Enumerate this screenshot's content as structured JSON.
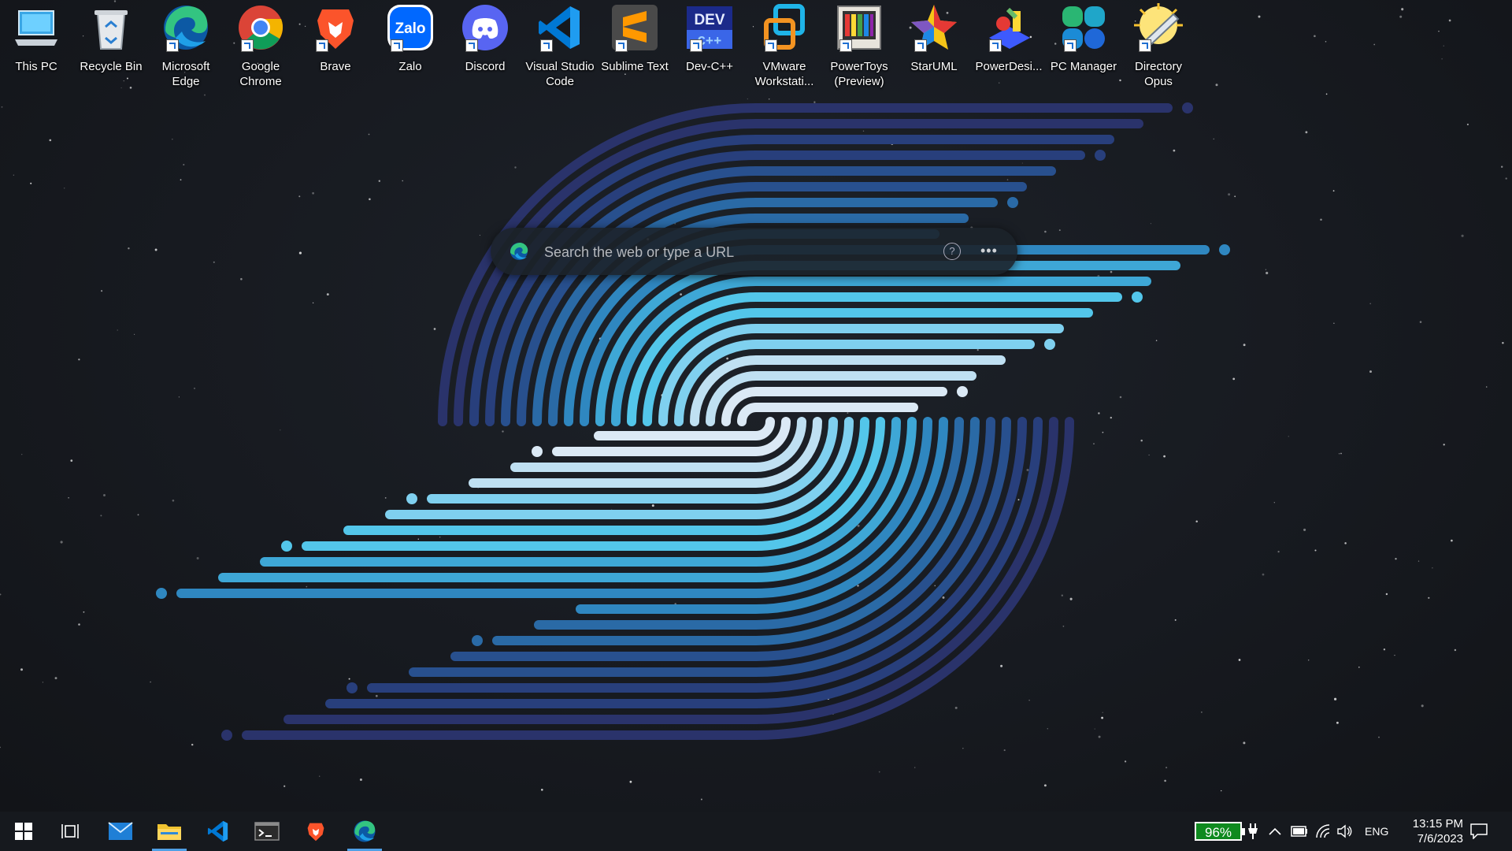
{
  "desktop_icons": [
    {
      "label": "This PC",
      "icon": "this-pc-icon"
    },
    {
      "label": "Recycle Bin",
      "icon": "recycle-bin-icon"
    },
    {
      "label": "Microsoft\nEdge",
      "icon": "edge-icon"
    },
    {
      "label": "Google\nChrome",
      "icon": "chrome-icon"
    },
    {
      "label": "Brave",
      "icon": "brave-icon"
    },
    {
      "label": "Zalo",
      "icon": "zalo-icon"
    },
    {
      "label": "Discord",
      "icon": "discord-icon"
    },
    {
      "label": "Visual Studio\nCode",
      "icon": "vscode-icon"
    },
    {
      "label": "Sublime Text",
      "icon": "sublime-icon"
    },
    {
      "label": "Dev-C++",
      "icon": "devcpp-icon"
    },
    {
      "label": "VMware\nWorkstati...",
      "icon": "vmware-icon"
    },
    {
      "label": "PowerToys\n(Preview)",
      "icon": "powertoys-icon"
    },
    {
      "label": "StarUML",
      "icon": "staruml-icon"
    },
    {
      "label": "PowerDesi...",
      "icon": "powerdesigner-icon"
    },
    {
      "label": "PC Manager",
      "icon": "pc-manager-icon"
    },
    {
      "label": "Directory\nOpus",
      "icon": "directory-opus-icon"
    }
  ],
  "search_widget": {
    "placeholder": "Search the web or type a URL",
    "help_glyph": "?",
    "more_glyph": "•••"
  },
  "taskbar": {
    "apps": [
      {
        "name": "start",
        "icon": "windows-logo-icon"
      },
      {
        "name": "task-view",
        "icon": "task-view-icon"
      },
      {
        "name": "mail",
        "icon": "mail-icon"
      },
      {
        "name": "file-explorer",
        "icon": "folder-icon",
        "active": true
      },
      {
        "name": "vscode",
        "icon": "vscode-icon"
      },
      {
        "name": "terminal",
        "icon": "terminal-icon"
      },
      {
        "name": "brave",
        "icon": "brave-icon"
      },
      {
        "name": "edge",
        "icon": "edge-icon",
        "active": true
      }
    ],
    "battery_percent": "96%",
    "language": "ENG",
    "time": "13:15 PM",
    "date": "7/6/2023"
  },
  "colors": {
    "taskbar_bg": "#16191e",
    "battery_green": "#0f8a1f",
    "active_underline": "#4fa0e6"
  }
}
